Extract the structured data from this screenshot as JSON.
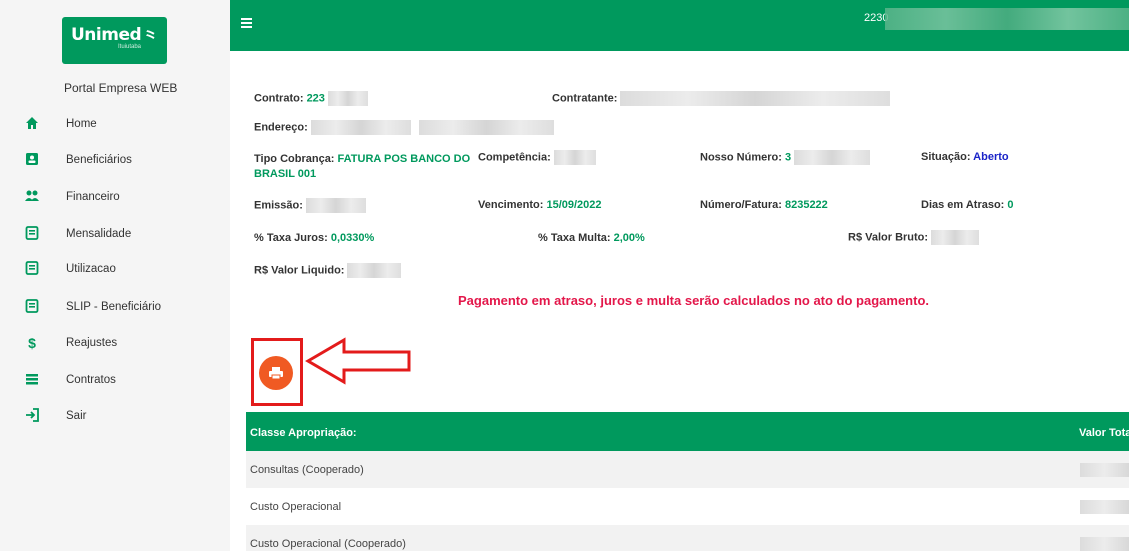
{
  "sidebar": {
    "logo_brand": "Unimed",
    "logo_sub": "Ituiutaba",
    "portal_title": "Portal Empresa WEB",
    "items": [
      {
        "label": "Home",
        "icon": "home-icon"
      },
      {
        "label": "Beneficiários",
        "icon": "id-card-icon"
      },
      {
        "label": "Financeiro",
        "icon": "users-icon"
      },
      {
        "label": "Mensalidade",
        "icon": "document-icon"
      },
      {
        "label": "Utilizacao",
        "icon": "document-icon"
      },
      {
        "label": "SLIP - Beneficiário",
        "icon": "document-icon"
      },
      {
        "label": "Reajustes",
        "icon": "dollar-icon"
      },
      {
        "label": "Contratos",
        "icon": "list-icon"
      },
      {
        "label": "Sair",
        "icon": "sign-out-icon"
      }
    ]
  },
  "header": {
    "user_id": "2230"
  },
  "details": {
    "contrato_label": "Contrato:",
    "contrato_value": "223",
    "contratante_label": "Contratante:",
    "endereco_label": "Endereço:",
    "tipo_cobranca_label": "Tipo Cobrança:",
    "tipo_cobranca_value_1": "FATURA POS BANCO DO",
    "tipo_cobranca_value_2": "BRASIL 001",
    "competencia_label": "Competência:",
    "nosso_numero_label": "Nosso Número:",
    "nosso_numero_value": "3",
    "situacao_label": "Situação:",
    "situacao_value": "Aberto",
    "emissao_label": "Emissão:",
    "vencimento_label": "Vencimento:",
    "vencimento_value": "15/09/2022",
    "numero_fatura_label": "Número/Fatura:",
    "numero_fatura_value": "8235222",
    "dias_atraso_label": "Dias em Atraso:",
    "dias_atraso_value": "0",
    "taxa_juros_label": "% Taxa Juros:",
    "taxa_juros_value": "0,0330%",
    "taxa_multa_label": "% Taxa Multa:",
    "taxa_multa_value": "2,00%",
    "valor_bruto_label": "R$ Valor Bruto:",
    "valor_liquido_label": "R$ Valor Liquido:"
  },
  "alert_message": "Pagamento em atraso, juros e multa serão calculados no ato do pagamento.",
  "table": {
    "headers": [
      "Classe Apropriação:",
      "Valor Total"
    ],
    "rows": [
      {
        "label": "Consultas (Cooperado)"
      },
      {
        "label": "Custo Operacional"
      },
      {
        "label": "Custo Operacional (Cooperado)"
      }
    ]
  },
  "colors": {
    "brand_green": "#00995d",
    "alert_red": "#e3174a",
    "print_orange": "#f05a23",
    "annotation_red": "#e31b1b"
  }
}
